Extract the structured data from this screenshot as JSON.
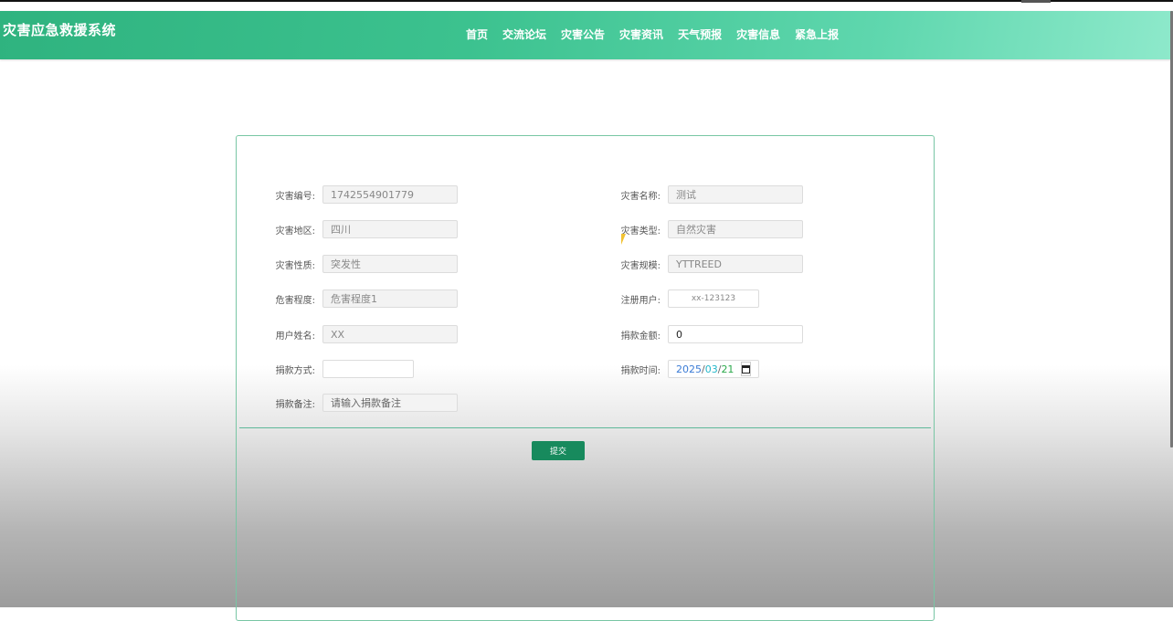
{
  "app": {
    "title": "灾害应急救援系统"
  },
  "nav": [
    "首页",
    "交流论坛",
    "灾害公告",
    "灾害资讯",
    "天气预报",
    "灾害信息",
    "紧急上报"
  ],
  "form": {
    "disaster_no": {
      "label": "灾害编号:",
      "value": "1742554901779"
    },
    "disaster_name": {
      "label": "灾害名称:",
      "value": "测试"
    },
    "region": {
      "label": "灾害地区:",
      "value": "四川"
    },
    "type": {
      "label": "灾害类型:",
      "value": "自然灾害"
    },
    "nature": {
      "label": "灾害性质:",
      "value": "突发性"
    },
    "scale": {
      "label": "灾害规模:",
      "value": "YTTREED"
    },
    "severity": {
      "label": "危害程度:",
      "value": "危害程度1"
    },
    "user": {
      "label": "注册用户:",
      "value": "xx-123123"
    },
    "username": {
      "label": "用户姓名:",
      "value": "XX"
    },
    "amount": {
      "label": "捐款金额:",
      "value": "0"
    },
    "method": {
      "label": "捐款方式:",
      "value": ""
    },
    "time": {
      "label": "捐款时间:",
      "year": "2025",
      "month": "03",
      "day": "21",
      "sep": "/"
    },
    "remark": {
      "label": "捐款备注:",
      "placeholder": "请输入捐款备注"
    },
    "submit_label": "提交"
  },
  "colors": {
    "header_start": "#2fb37f",
    "header_end": "#8ee9cb",
    "submit": "#178a5d",
    "card_border": "#78c6a4"
  }
}
